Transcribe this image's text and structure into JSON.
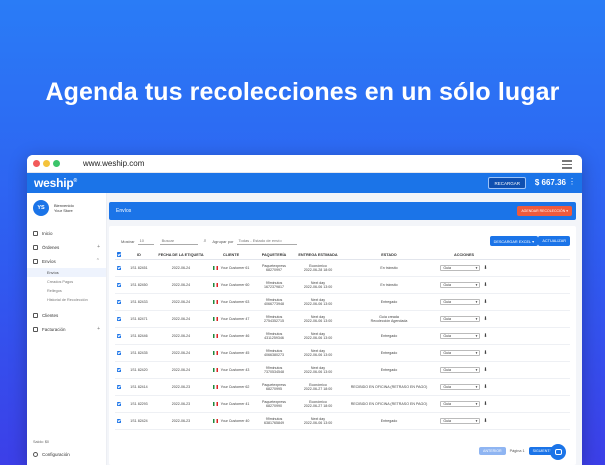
{
  "headline": "Agenda tus recolecciones en un sólo lugar",
  "browser": {
    "url": "www.weship.com"
  },
  "topbar": {
    "logo": "weship",
    "recharge_label": "RECARGAR",
    "balance": "$ 667.36"
  },
  "user": {
    "initials": "YS",
    "greeting": "Bienvenido",
    "name": "Your Store"
  },
  "sidebar": {
    "items": [
      {
        "label": "Inicio",
        "icon": "home-icon"
      },
      {
        "label": "Órdenes",
        "icon": "orders-icon"
      },
      {
        "label": "Envíos",
        "icon": "shipping-icon"
      }
    ],
    "subitems": [
      {
        "label": "Envíos",
        "active": true
      },
      {
        "label": "Creados Pagos",
        "active": false
      },
      {
        "label": "Rellegos",
        "active": false
      },
      {
        "label": "Historial de Recolección",
        "active": false
      }
    ],
    "items2": [
      {
        "label": "Clientes",
        "icon": "clients-icon"
      },
      {
        "label": "Facturación",
        "icon": "billing-icon"
      }
    ],
    "saldo": "Saldo: $0",
    "config": "Configuración"
  },
  "banner": {
    "title": "Envíos",
    "schedule_button": "AGENDAR RECOLECCIÓN ▾"
  },
  "filters": {
    "show_label": "Mostrar",
    "show_value": "10",
    "search_placeholder": "Buscar",
    "filter_label": "Agrupar por",
    "filter_value": "Todas - Estado de envío",
    "download_button": "DESCARGAR EXCEL ▾",
    "update_button": "ACTUALIZAR"
  },
  "table": {
    "headers": [
      "",
      "ID",
      "FECHA DE LA ETIQUETA",
      "CLIENTE",
      "PAQUETERÍA",
      "ENTREGA ESTIMADA",
      "ESTADO",
      "ACCIONES"
    ],
    "rows": [
      {
        "id": "1S1 82451",
        "date": "2022-06-24",
        "client": "Your Customer 61",
        "carrier": "Paquetexpress",
        "tracking": "68270997",
        "eta": "Económico",
        "eta2": "2022-06-28 18:00",
        "status": "En tránsito",
        "status2": ""
      },
      {
        "id": "1S1 82450",
        "date": "2022-06-24",
        "client": "Your Customer 60",
        "carrier": "99minutos",
        "tracking": "1672379817",
        "eta": "Next day",
        "eta2": "2022-06-06 13:00",
        "status": "En tránsito",
        "status2": ""
      },
      {
        "id": "1S1 82433",
        "date": "2022-06-24",
        "client": "Your Customer 63",
        "carrier": "99minutos",
        "tracking": "4066773948",
        "eta": "Next day",
        "eta2": "2022-06-06 13:00",
        "status": "Entregado",
        "status2": ""
      },
      {
        "id": "1S1 82471",
        "date": "2022-06-24",
        "client": "Your Customer 47",
        "carrier": "99minutos",
        "tracking": "2754352715",
        "eta": "Next day",
        "eta2": "2022-06-06 13:00",
        "status": "Guía creada",
        "status2": "Recolección Agendada"
      },
      {
        "id": "1S1 82446",
        "date": "2022-06-24",
        "client": "Your Customer 46",
        "carrier": "99minutos",
        "tracking": "4311259346",
        "eta": "Next day",
        "eta2": "2022-06-06 13:00",
        "status": "Entregado",
        "status2": ""
      },
      {
        "id": "1S1 82435",
        "date": "2022-06-24",
        "client": "Your Customer 45",
        "carrier": "99minutos",
        "tracking": "4066380273",
        "eta": "Next day",
        "eta2": "2022-06-06 13:00",
        "status": "Entregado",
        "status2": ""
      },
      {
        "id": "1S1 82420",
        "date": "2022-06-24",
        "client": "Your Customer 43",
        "carrier": "99minutos",
        "tracking": "7370534548",
        "eta": "Next day",
        "eta2": "2022-06-06 13:00",
        "status": "Entregado",
        "status2": ""
      },
      {
        "id": "1S1 82414",
        "date": "2022-06-23",
        "client": "Your Customer 62",
        "carrier": "Paquetexpress",
        "tracking": "68270995",
        "eta": "Económico",
        "eta2": "2022-06-27 18:00",
        "status": "RECIBIDO EN OFICINA (RETRASO EN PAGO)",
        "status2": ""
      },
      {
        "id": "1S1 82293",
        "date": "2022-06-23",
        "client": "Your Customer 41",
        "carrier": "Paquetexpress",
        "tracking": "68270990",
        "eta": "Económico",
        "eta2": "2022-06-27 18:00",
        "status": "RECIBIDO EN OFICINA (RETRASO EN PAGO)",
        "status2": ""
      },
      {
        "id": "1S1 82424",
        "date": "2022-06-23",
        "client": "Your Customer 40",
        "carrier": "99minutos",
        "tracking": "6381765849",
        "eta": "Next day",
        "eta2": "2022-06-06 13:00",
        "status": "Entregado",
        "status2": ""
      }
    ],
    "action_option": "Guía"
  },
  "pager": {
    "prev": "ANTERIOR",
    "page_text": "Página 1",
    "next": "SIGUIENTE"
  },
  "colors": {
    "primary": "#1b74e8",
    "accent": "#f05a3c"
  }
}
